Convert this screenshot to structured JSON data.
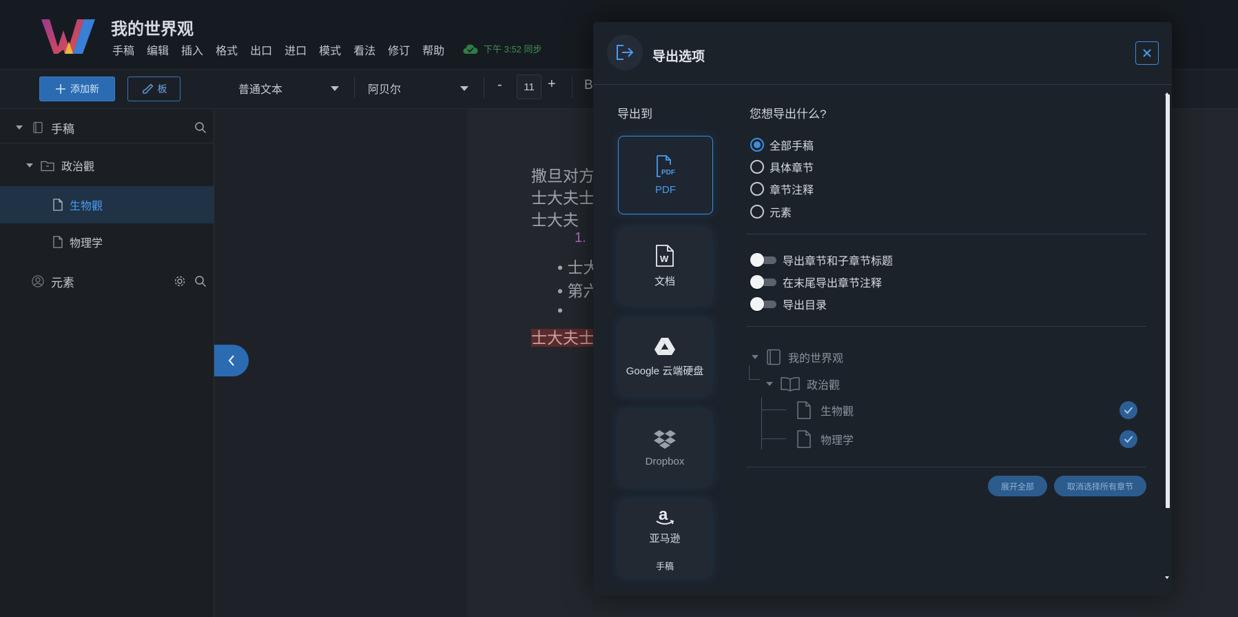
{
  "app": {
    "title": "我的世界观",
    "menu": [
      "手稿",
      "编辑",
      "插入",
      "格式",
      "出口",
      "进口",
      "模式",
      "看法",
      "修订",
      "帮助"
    ],
    "sync_status": "下午 3:52 同步",
    "colors": {
      "accent": "#3b8ee0",
      "sync": "#3f8f52",
      "background": "#1b1f24"
    }
  },
  "toolbar": {
    "add_new_label": "添加新",
    "board_label": "板",
    "style_value": "普通文本",
    "font_value": "阿贝尔",
    "size_minus": "-",
    "font_size": "11",
    "size_plus": "+",
    "bold_label": "B"
  },
  "sidebar": {
    "manuscript_label": "手稿",
    "folder_label": "政治觀",
    "docs": [
      "生物觀",
      "物理学"
    ],
    "elements_label": "元素"
  },
  "document": {
    "lines": [
      "撒旦对方",
      "士大夫士",
      "士大夫"
    ],
    "numbered_item": "1.",
    "bullets": [
      "士大",
      "第六",
      ""
    ],
    "highlight_text": "士大夫士"
  },
  "modal": {
    "title": "导出选项",
    "export_to_label": "导出到",
    "targets": [
      {
        "label": "PDF",
        "icon": "pdf-file-icon"
      },
      {
        "label": "文档",
        "icon": "word-file-icon"
      },
      {
        "label": "Google 云端硬盘",
        "icon": "google-drive-icon"
      },
      {
        "label": "Dropbox",
        "icon": "dropbox-icon"
      },
      {
        "label": "亚马逊",
        "sublabel": "手稿",
        "icon": "amazon-icon"
      }
    ],
    "question": "您想导出什么?",
    "scope_options": [
      {
        "label": "全部手稿",
        "checked": true
      },
      {
        "label": "具体章节",
        "checked": false
      },
      {
        "label": "章节注释",
        "checked": false
      },
      {
        "label": "元素",
        "checked": false
      }
    ],
    "toggles": [
      {
        "label": "导出章节和子章节标题",
        "on": false
      },
      {
        "label": "在末尾导出章节注释",
        "on": false
      },
      {
        "label": "导出目录",
        "on": false
      }
    ],
    "tree": {
      "root": "我的世界观",
      "folder": "政治觀",
      "docs": [
        "生物觀",
        "物理学"
      ]
    },
    "expand_all_label": "展开全部",
    "deselect_all_label": "取消选择所有章节"
  }
}
